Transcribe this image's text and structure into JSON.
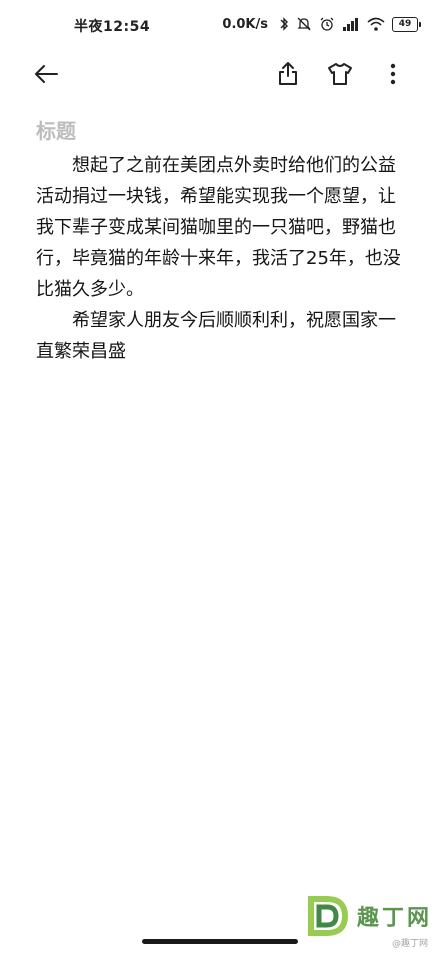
{
  "status_bar": {
    "time": "半夜12:54",
    "net_speed": "0.0K/s",
    "battery": "49",
    "icons": [
      "bluetooth-icon",
      "mute-icon",
      "alarm-icon",
      "signal-icon",
      "wifi-icon",
      "battery-icon"
    ]
  },
  "toolbar": {
    "icons": [
      "back-arrow-icon",
      "share-icon",
      "theme-shirt-icon",
      "more-vertical-icon"
    ]
  },
  "note": {
    "title_placeholder": "标题",
    "paragraphs": [
      "想起了之前在美团点外卖时给他们的公益活动捐过一块钱，希望能实现我一个愿望，让我下辈子变成某间猫咖里的一只猫吧，野猫也行，毕竟猫的年龄十来年，我活了25年，也没比猫久多少。",
      "希望家人朋友今后顺顺利利，祝愿国家一直繁荣昌盛"
    ]
  },
  "watermark": {
    "brand": "趣丁网",
    "handle": "@趣丁网"
  },
  "colors": {
    "title_placeholder": "#bdbdbd",
    "text": "#151515",
    "watermark": "#4a8a3b"
  }
}
